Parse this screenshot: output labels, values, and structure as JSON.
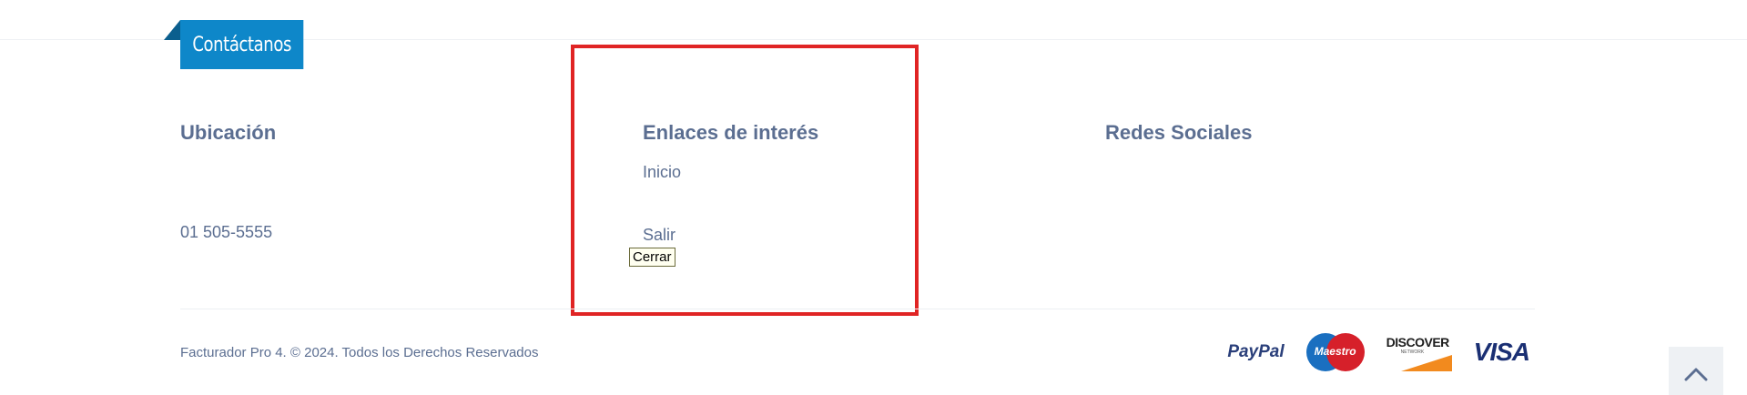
{
  "contact": {
    "tab_label": "Contáctanos"
  },
  "footer": {
    "location": {
      "heading": "Ubicación",
      "phone": "01 505-5555"
    },
    "links": {
      "heading": "Enlaces de interés",
      "items": [
        {
          "label": "Inicio"
        },
        {
          "label": "Salir"
        }
      ],
      "tooltip": "Cerrar"
    },
    "social": {
      "heading": "Redes Sociales"
    },
    "copyright": "Facturador Pro 4. © 2024. Todos los Derechos Reservados",
    "payments": {
      "paypal": "PayPal",
      "maestro": "Maestro",
      "discover": "DISCOVER",
      "discover_sub": "NETWORK",
      "visa": "VISA"
    }
  },
  "icons": {
    "scroll_top": "chevron-up-icon"
  },
  "colors": {
    "accent": "#0e87c9",
    "text": "#5b6e91",
    "highlight": "#e02424"
  }
}
